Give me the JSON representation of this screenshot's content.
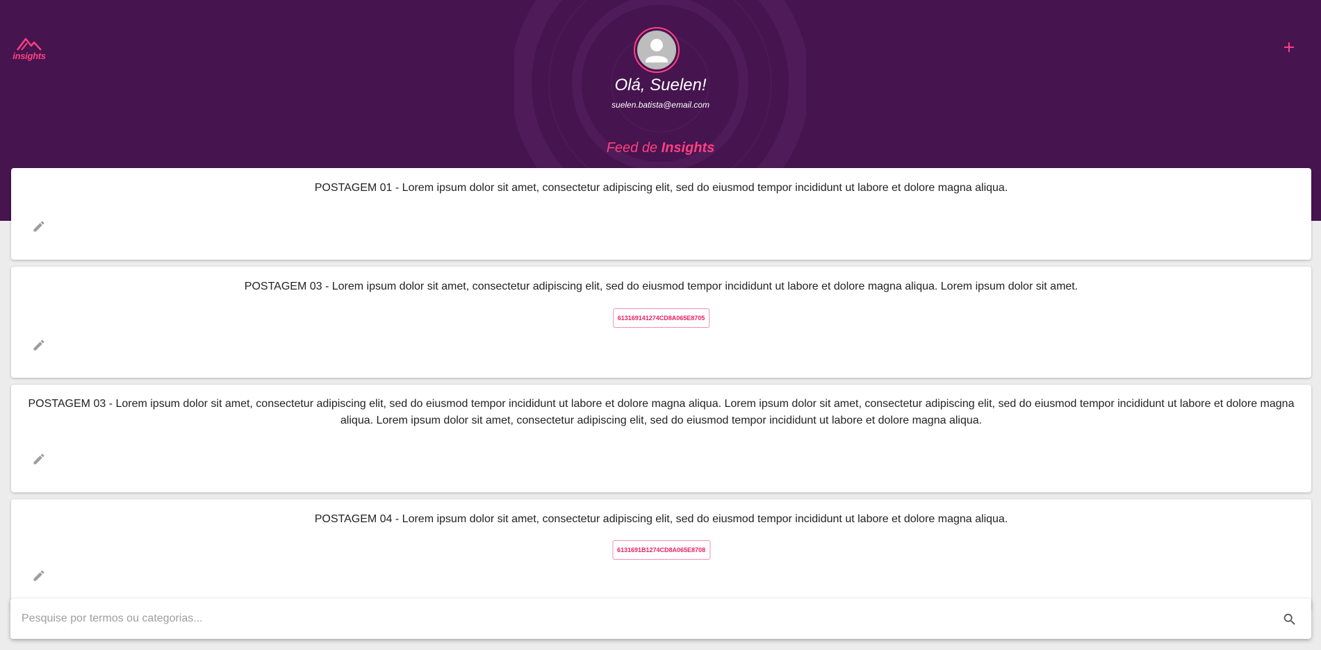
{
  "brand": {
    "logo_text": "insights",
    "accent_color": "#ff4081",
    "header_color": "#46144f"
  },
  "header": {
    "greeting": "Olá, Suelen!",
    "email": "suelen.batista@email.com",
    "feed_title_prefix": "Feed de ",
    "feed_title_highlight": "Insights",
    "add_icon": "plus-icon",
    "avatar_icon": "person-icon"
  },
  "posts": [
    {
      "text": "POSTAGEM 01 - Lorem ipsum dolor sit amet, consectetur adipiscing elit, sed do eiusmod tempor incididunt ut labore et dolore magna aliqua.",
      "tag": null
    },
    {
      "text": "POSTAGEM 03 - Lorem ipsum dolor sit amet, consectetur adipiscing elit, sed do eiusmod tempor incididunt ut labore et dolore magna aliqua. Lorem ipsum dolor sit amet.",
      "tag": "613169141274CD8A065E8705"
    },
    {
      "text": "POSTAGEM 03 - Lorem ipsum dolor sit amet, consectetur adipiscing elit, sed do eiusmod tempor incididunt ut labore et dolore magna aliqua. Lorem ipsum dolor sit amet, consectetur adipiscing elit, sed do eiusmod tempor incididunt ut labore et dolore magna aliqua. Lorem ipsum dolor sit amet, consectetur adipiscing elit, sed do eiusmod tempor incididunt ut labore et dolore magna aliqua.",
      "tag": null
    },
    {
      "text": "POSTAGEM 04 - Lorem ipsum dolor sit amet, consectetur adipiscing elit, sed do eiusmod tempor incididunt ut labore et dolore magna aliqua.",
      "tag": "6131691B1274CD8A065E8708"
    }
  ],
  "search": {
    "placeholder": "Pesquise por termos ou categorias...",
    "value": "",
    "icon": "search-icon"
  }
}
